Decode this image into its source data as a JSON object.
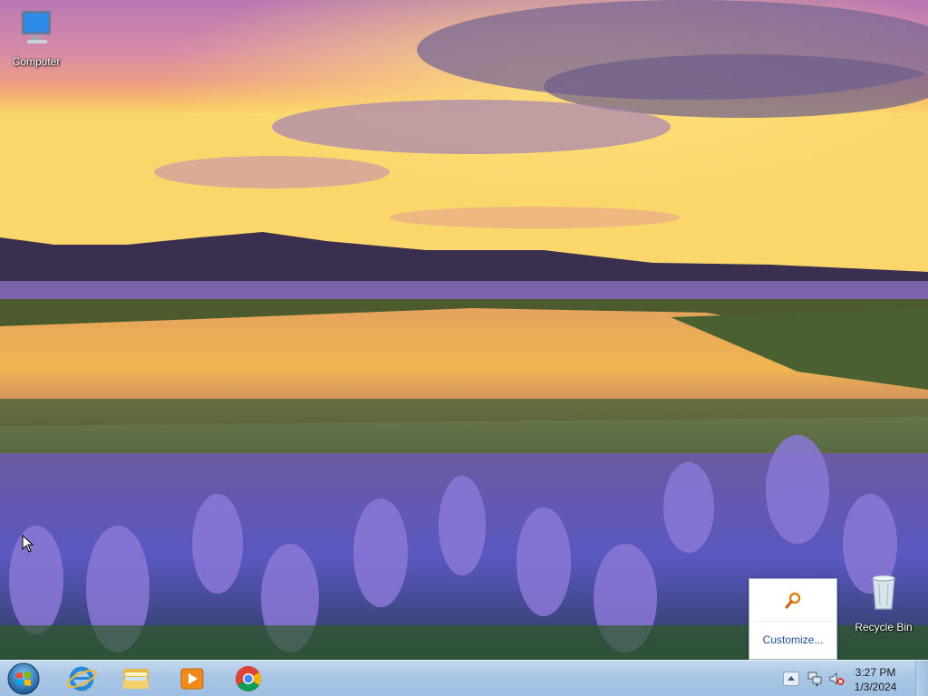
{
  "desktop": {
    "icons": [
      {
        "label": "Computer",
        "icon": "computer-icon"
      },
      {
        "label": "Recycle Bin",
        "icon": "recycle-bin-icon"
      }
    ]
  },
  "tray_popup": {
    "icon": "search-magnifier-icon",
    "link_label": "Customize..."
  },
  "taskbar": {
    "start": "windows-start-orb-icon",
    "pinned": [
      {
        "name": "Internet Explorer",
        "icon": "internet-explorer-icon"
      },
      {
        "name": "Windows Explorer",
        "icon": "folder-explorer-icon"
      },
      {
        "name": "Windows Media Player",
        "icon": "media-player-icon"
      },
      {
        "name": "Google Chrome",
        "icon": "chrome-icon"
      }
    ],
    "tray": {
      "icons": [
        "show-hidden-icons-arrow",
        "network-icon",
        "volume-muted-icon"
      ],
      "time": "3:27 PM",
      "date": "1/3/2024"
    }
  },
  "colors": {
    "taskbar": "#a9c6e5",
    "link": "#1e4e9a"
  }
}
